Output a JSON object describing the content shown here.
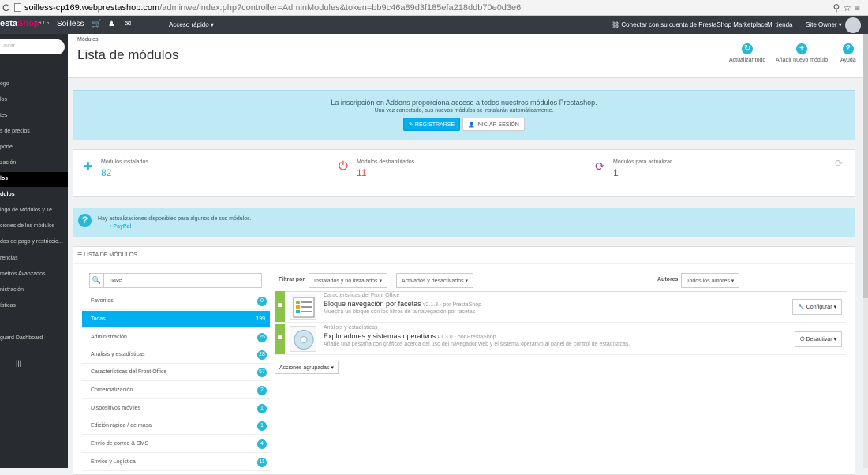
{
  "browser": {
    "url_host": "soilless-cp169.webprestashop.com",
    "url_path": "/adminwe/index.php?controller=AdminModules&token=bb9c46a89d3f185efa218ddb70e0d3e6"
  },
  "topbar": {
    "logo_white": "esta",
    "logo_red": "Shop",
    "version": "1.6.1.5",
    "shop_name": "Soilless",
    "quick_access": "Acceso rápido ▾",
    "connect": "Conectar con su cuenta de PrestaShop Marketplace",
    "my_shop": "Mi tienda",
    "owner": "Site Owner ▾"
  },
  "sidebar": {
    "search_placeholder": "uscar",
    "items": [
      {
        "label": "ogo"
      },
      {
        "label": "los"
      },
      {
        "label": "tes"
      },
      {
        "label": "s de precios"
      },
      {
        "label": "porte"
      },
      {
        "label": "zación"
      },
      {
        "label": "los"
      },
      {
        "label": "dulos"
      },
      {
        "label": "logo de Módulos y Te..."
      },
      {
        "label": "ciones de los módulos"
      },
      {
        "label": "dos de pago y restriccio..."
      },
      {
        "label": "rencias"
      },
      {
        "label": "metros Avanzados"
      },
      {
        "label": "nistración"
      },
      {
        "label": "ísticas"
      },
      {
        "label": "guard Dashboard"
      }
    ]
  },
  "header": {
    "breadcrumb": "Módulos",
    "title": "Lista de módulos",
    "toolbar": [
      {
        "label": "Actualizar todo",
        "icon": "↻",
        "color": "#25b9d7"
      },
      {
        "label": "Añadir nuevo módulo",
        "icon": "+",
        "color": "#25b9d7"
      },
      {
        "label": "Ayuda",
        "icon": "?",
        "color": "#25b9d7"
      }
    ]
  },
  "addons": {
    "headline": "La inscripción en Addons proporciona acceso a todos nuestros módulos Prestashop.",
    "subline": "Una vez conectado, sus nuevos módulos se instalarán automáticamente.",
    "register": "✎ REGISTRARSE",
    "login": "👤 INICIAR SESIÓN"
  },
  "stats": [
    {
      "label": "Módulos instalados",
      "value": "82",
      "color": "#25b9d7",
      "icon": "✚"
    },
    {
      "label": "Módulos deshabilitados",
      "value": "11",
      "color": "#e24c3a",
      "icon": "⏻"
    },
    {
      "label": "Módulos para actualizar",
      "value": "1",
      "color": "#a53b8f",
      "icon": "⟳"
    }
  ],
  "updates": {
    "message": "Hay actualizaciones disponibles para algunos de sus módulos.",
    "item": "• PayPal"
  },
  "module_list": {
    "panel_title": "☰ LISTA DE MÓDULOS",
    "search_value": "nave",
    "categories": [
      {
        "name": "Favoritos",
        "count": "0"
      },
      {
        "name": "Todas",
        "count": "199"
      },
      {
        "name": "Administración",
        "count": "25"
      },
      {
        "name": "Análisis y estadísticas",
        "count": "28"
      },
      {
        "name": "Características del Front Office",
        "count": "57"
      },
      {
        "name": "Comercialización",
        "count": "2"
      },
      {
        "name": "Dispositivos móviles",
        "count": "1"
      },
      {
        "name": "Edición rápida / de masa",
        "count": "1"
      },
      {
        "name": "Envío de correo & SMS",
        "count": "4"
      },
      {
        "name": "Envíos y Logística",
        "count": "11"
      }
    ],
    "filter_label": "Filtrar por",
    "filter_install": "Instalados y no instalados  ▾",
    "filter_active": "Activados y desactivados  ▾",
    "authors_label": "Autores",
    "authors_select": "Todos los autores          ▾",
    "modules": [
      {
        "category": "Características del Front Office",
        "name": "Bloque navegación por facetas",
        "version": "v2.1.3 - por PrestaShop",
        "description": "Muestra un bloque con los filtros de la navegación por facetas",
        "action": "🔧 Configurar  ▾"
      },
      {
        "category": "Análisis y estadísticas",
        "name": "Exploradores y sistemas operativos",
        "version": "v1.3.0 - por PrestaShop",
        "description": "Añade una pestaña con gráficos acerca del uso del navegador web y el sistema operativo al panel de control de estadísticas.",
        "action": "⏻ Desactivar  ▾"
      }
    ],
    "bulk_actions": "Acciones agrupadas ▾"
  }
}
